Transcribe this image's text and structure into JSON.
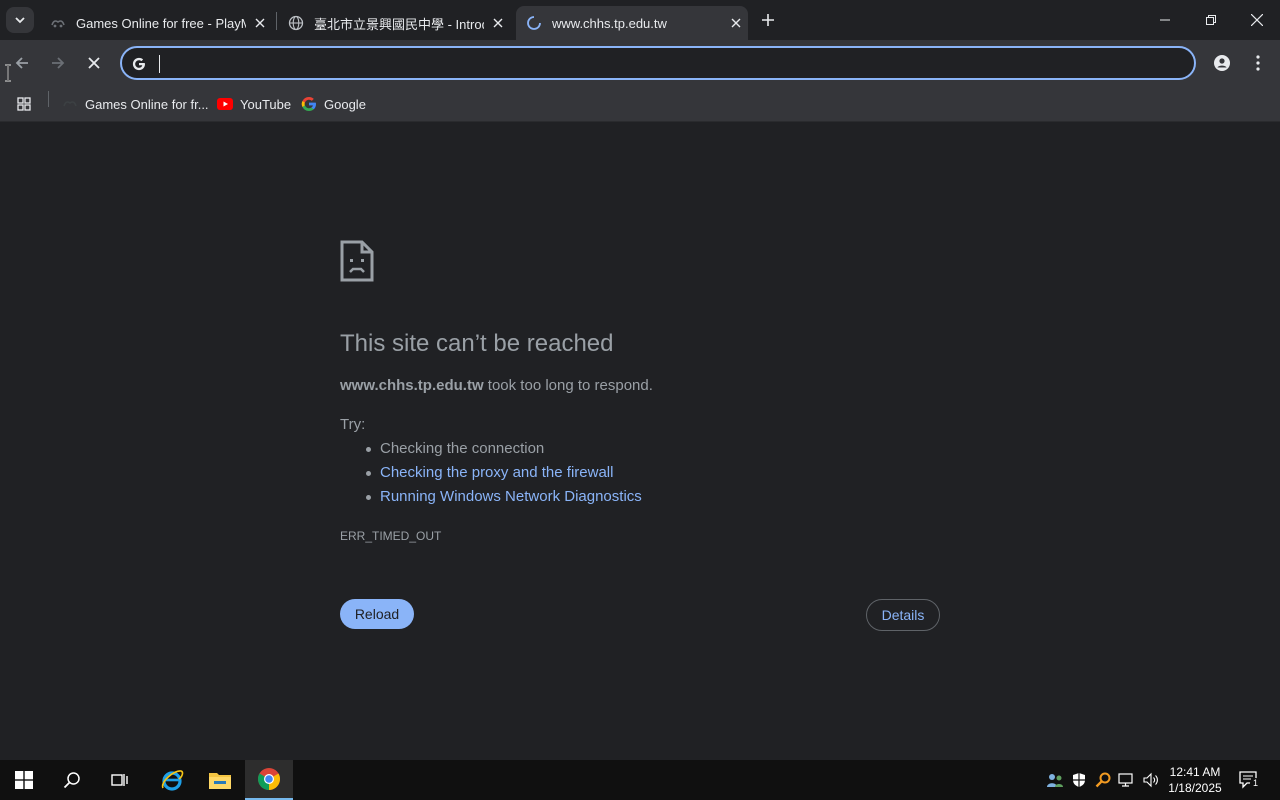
{
  "tabs": [
    {
      "title": "Games Online for free - PlayMini",
      "active": false
    },
    {
      "title": "臺北市立景興國民中學 - Introduction",
      "active": false
    },
    {
      "title": "www.chhs.tp.edu.tw",
      "active": true
    }
  ],
  "omnibox": {
    "value": "",
    "icon": "google-g-icon"
  },
  "bookmarks": [
    {
      "label": "Games Online for fr...",
      "icon": "playmini-icon"
    },
    {
      "label": "YouTube",
      "icon": "youtube-icon"
    },
    {
      "label": "Google",
      "icon": "google-icon"
    }
  ],
  "error": {
    "title": "This site can’t be reached",
    "host": "www.chhs.tp.edu.tw",
    "message": " took too long to respond.",
    "try_label": "Try:",
    "suggestions": [
      {
        "text": "Checking the connection",
        "link": false
      },
      {
        "text": "Checking the proxy and the firewall",
        "link": true
      },
      {
        "text": "Running Windows Network Diagnostics",
        "link": true
      }
    ],
    "code": "ERR_TIMED_OUT",
    "reload_label": "Reload",
    "details_label": "Details"
  },
  "taskbar": {
    "time": "12:41 AM",
    "date": "1/18/2025",
    "notification_count": "1"
  },
  "colors": {
    "accent": "#8ab4f8",
    "page_bg": "#202124",
    "toolbar_bg": "#35363a"
  }
}
